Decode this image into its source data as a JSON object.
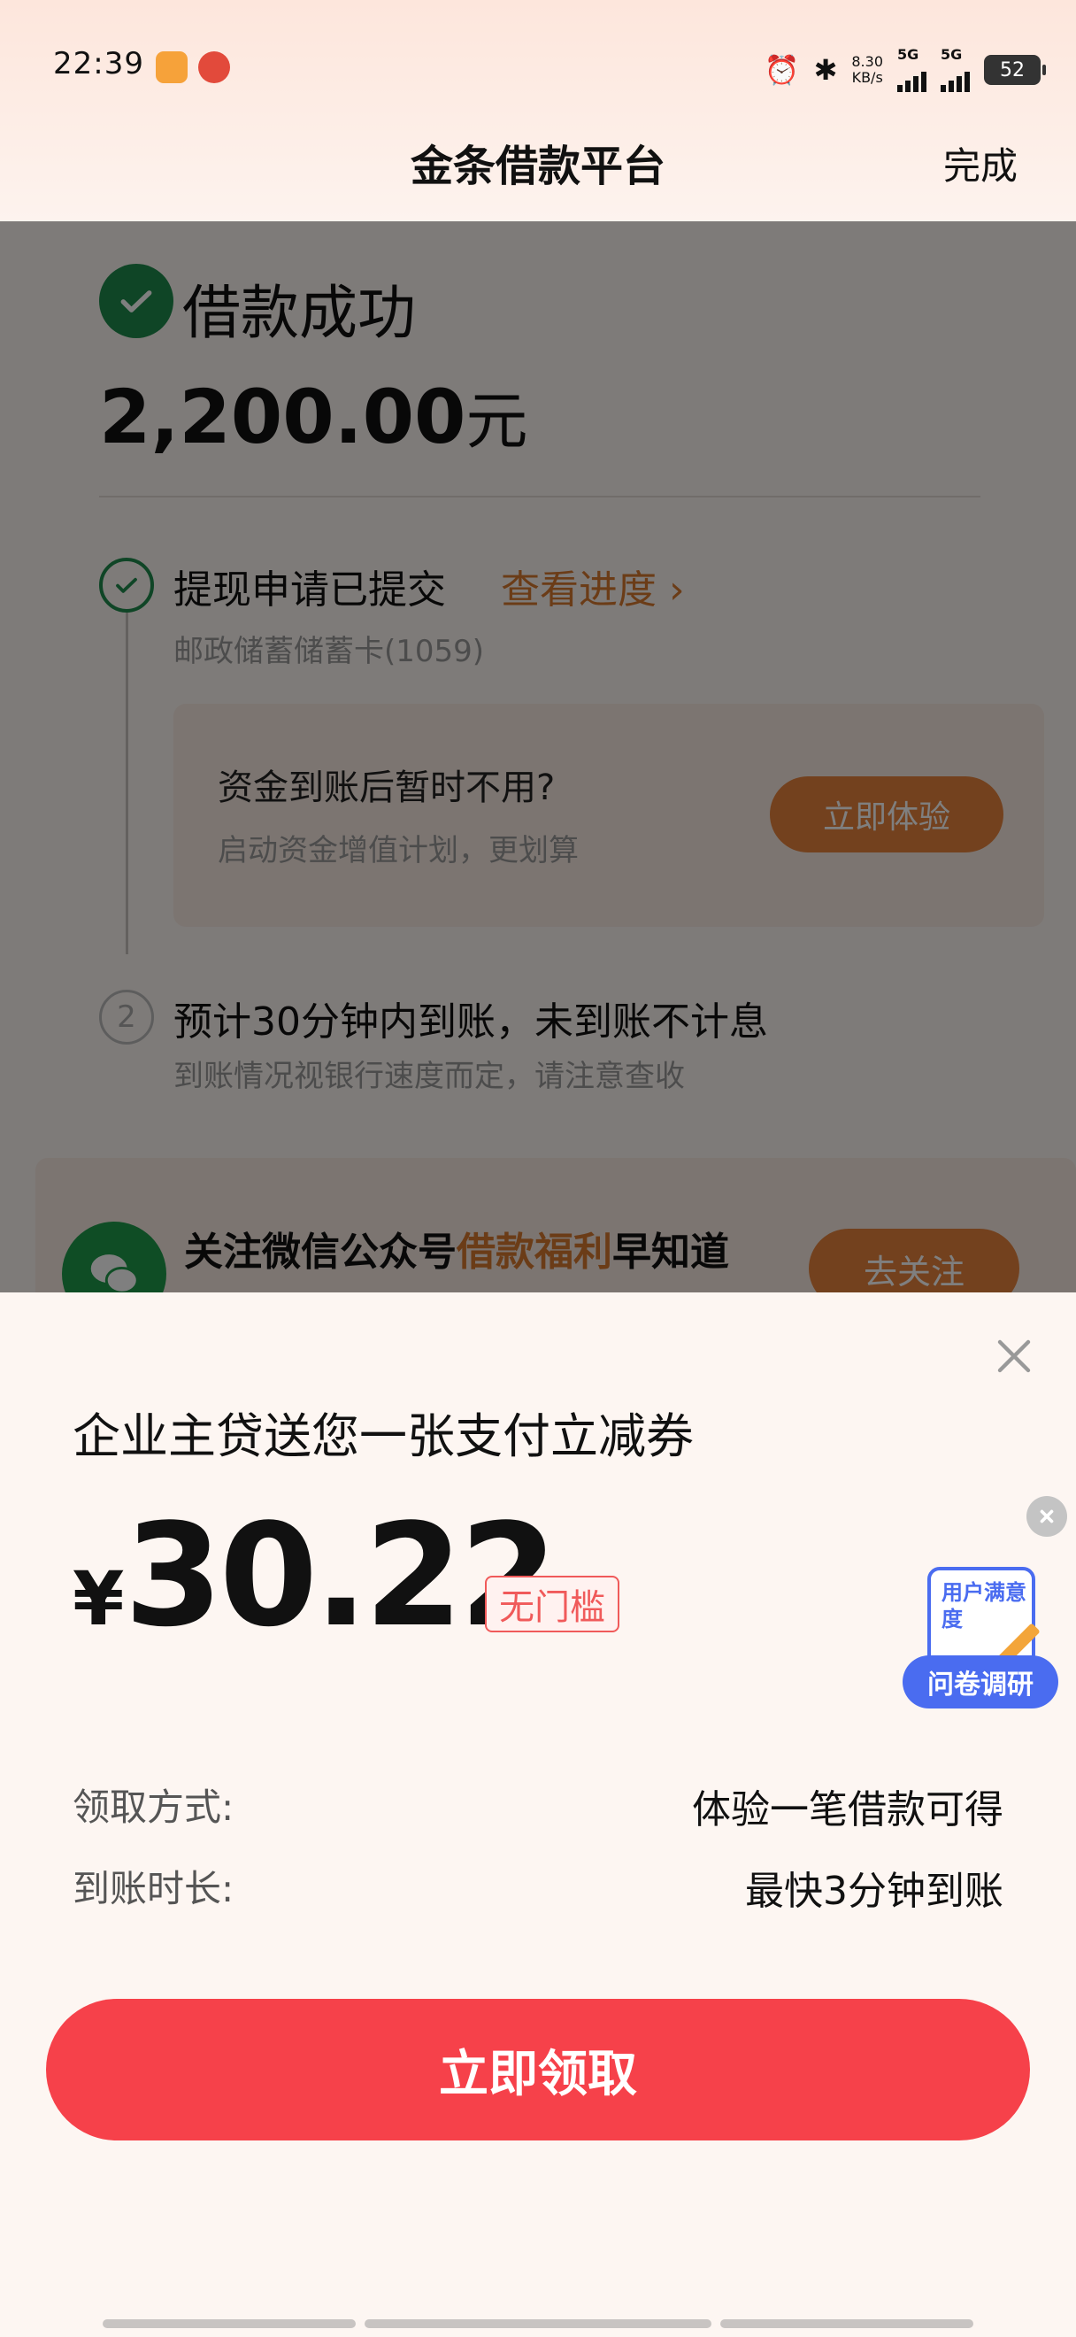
{
  "status_bar": {
    "time": "22:39",
    "net_speed": "8.30",
    "net_unit": "KB/s",
    "sig1": "5G",
    "sig2": "5G",
    "battery": "52"
  },
  "header": {
    "title": "金条借款平台",
    "done": "完成"
  },
  "result": {
    "title": "借款成功",
    "amount": "2,200.00",
    "unit": "元"
  },
  "steps": {
    "step1_text": "提现申请已提交",
    "progress_link": "查看进度 ›",
    "bank": "邮政储蓄储蓄卡(1059)",
    "promo_title": "资金到账后暂时不用?",
    "promo_sub": "启动资金增值计划，更划算",
    "promo_btn": "立即体验",
    "step2_num": "2",
    "step2_text": "预计30分钟内到账，未到账不计息",
    "step2_sub": "到账情况视银行速度而定，请注意查收"
  },
  "wechat": {
    "text_a": "关注微信公众号",
    "text_hl": "借款福利",
    "text_b": "早知道",
    "btn": "去关注"
  },
  "sheet": {
    "title": "企业主贷送您一张支付立减券",
    "currency": "¥",
    "value": "30.22",
    "badge": "无门槛",
    "survey_card": "用户满意度",
    "survey_label": "问卷调研",
    "rows": [
      {
        "label": "领取方式:",
        "value": "体验一笔借款可得"
      },
      {
        "label": "到账时长:",
        "value": "最快3分钟到账"
      }
    ],
    "claim_btn": "立即领取"
  },
  "colors": {
    "accent_green": "#1f8a4c",
    "accent_orange": "#e6833c",
    "claim_red": "#f6414a",
    "survey_blue": "#4a6cf0"
  }
}
